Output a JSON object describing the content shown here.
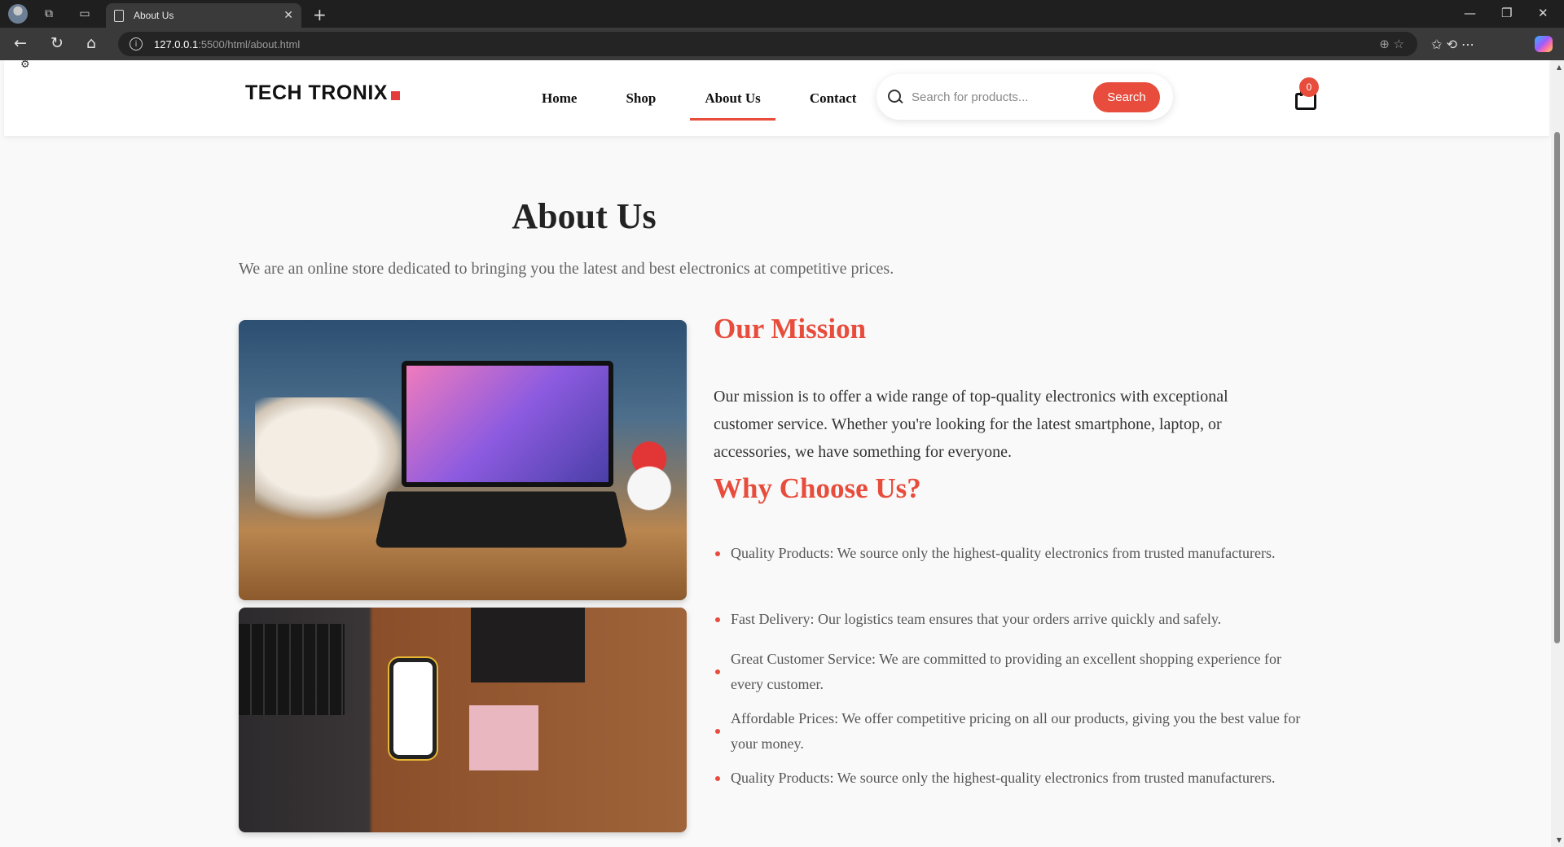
{
  "browser": {
    "tab_title": "About Us",
    "tab_close": "✕",
    "new_tab": "+",
    "url_host": "127.0.0.1",
    "url_path": ":5500/html/about.html",
    "info_glyph": "i",
    "window_controls": {
      "minimize": "—",
      "restore": "❐",
      "close": "✕"
    },
    "nav_glyphs": {
      "back": "←",
      "reload": "↻",
      "home": "⌂"
    },
    "url_icons": "⊕   ☆",
    "toolbar_icons": "✩   ⟲   ⋯",
    "icons": [
      "back-icon",
      "reload-icon",
      "home-icon",
      "zoom-icon",
      "favorite-star-icon",
      "collections-icon",
      "history-icon",
      "more-icon",
      "copilot-icon"
    ]
  },
  "header": {
    "logo_text": "TECH TRONIX",
    "nav": [
      {
        "label": "Home",
        "active": false
      },
      {
        "label": "Shop",
        "active": false
      },
      {
        "label": "About Us",
        "active": true
      },
      {
        "label": "Contact",
        "active": false
      }
    ],
    "search": {
      "placeholder": "Search for products...",
      "value": "",
      "button_label": "Search"
    },
    "cart_count": "0"
  },
  "main": {
    "title": "About Us",
    "intro": "We are an online store dedicated to bringing you the latest and best electronics at competitive prices.",
    "mission": {
      "heading": "Our Mission",
      "text": "Our mission is to offer a wide range of top-quality electronics with exceptional customer service. Whether you're looking for the latest smartphone, laptop, or accessories, we have something for everyone."
    },
    "why": {
      "heading": "Why Choose Us?",
      "items": [
        "Quality Products: We source only the highest-quality electronics from trusted manufacturers.",
        "Fast Delivery: Our logistics team ensures that your orders arrive quickly and safely.",
        "Great Customer Service: We are committed to providing an excellent shopping experience for every customer.",
        "Affordable Prices: We offer competitive pricing on all our products, giving you the best value for your money.",
        "Quality Products: We source only the highest-quality electronics from trusted manufacturers."
      ]
    }
  },
  "colors": {
    "accent": "#e74c3c",
    "text": "#333333",
    "muted": "#666666",
    "browser_bg": "#1f1f1f"
  }
}
